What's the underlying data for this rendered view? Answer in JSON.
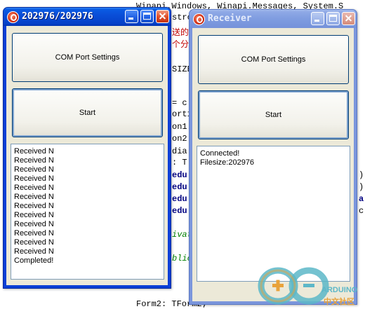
{
  "background_code": {
    "lines": [
      {
        "text": "Winapi.Windows, Winapi.Messages, System.S"
      },
      {
        "text": "strct"
      },
      {
        "text": "送的"
      },
      {
        "text": "个分"
      },
      {
        "text": "SIZE"
      },
      {
        "text": "= c"
      },
      {
        "text": "ort1"
      },
      {
        "text": "on1"
      },
      {
        "text": "on2"
      },
      {
        "text": "dia."
      },
      {
        "text": ": T"
      },
      {
        "text": "edu"
      },
      {
        "text": "edu"
      },
      {
        "text": "edu"
      },
      {
        "text": "edu"
      },
      {
        "text": "ivat"
      },
      {
        "text": "blic"
      },
      {
        "text": "Form2: TForm2;"
      }
    ],
    "right_edge_marks": [
      ")",
      ")",
      "a",
      "c"
    ]
  },
  "sender_window": {
    "title": "202976/202976",
    "com_button_label": "COM Port Settings",
    "start_button_label": "Start",
    "log_lines": [
      "Received N",
      "Received N",
      "Received N",
      "Received N",
      "Received N",
      "Received N",
      "Received N",
      "Received N",
      "Received N",
      "Received N",
      "Received N",
      "Received N",
      "Completed!"
    ]
  },
  "receiver_window": {
    "title": "Receiver",
    "com_button_label": "COM Port Settings",
    "start_button_label": "Start",
    "log_lines": [
      "Connected!",
      "Filesize:202976"
    ]
  },
  "logo": {
    "name": "arduino-logo",
    "text_en": "ARDUINO",
    "text_cn": "中文社区"
  },
  "colors": {
    "titlebar_active": "#0a4ed8",
    "titlebar_inactive": "#7f9ce0",
    "client_bg": "#ece9d8",
    "close_red": "#e04d26"
  }
}
